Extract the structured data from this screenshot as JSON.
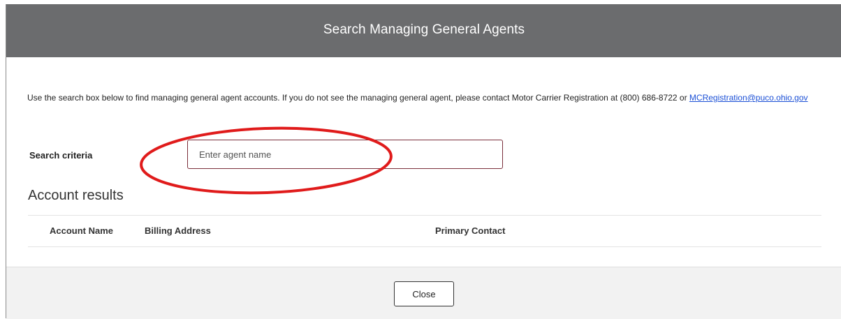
{
  "modal": {
    "title": "Search Managing General Agents"
  },
  "intro": {
    "text_before_link": "Use the search box below to find managing general agent accounts. If you do not see the managing general agent, please contact Motor Carrier Registration at (800) 686-8722 or ",
    "link_text": "MCRegistration@puco.ohio.gov"
  },
  "search": {
    "label": "Search criteria",
    "placeholder": "Enter agent name",
    "value": ""
  },
  "results": {
    "title": "Account results",
    "columns": [
      "Account Name",
      "Billing Address",
      "Primary Contact"
    ]
  },
  "footer": {
    "close_label": "Close"
  },
  "colors": {
    "header_bg": "#6b6c6e",
    "input_border": "#7a2e3a",
    "link": "#1a4fd6",
    "annotation_circle": "#e01b1b"
  }
}
